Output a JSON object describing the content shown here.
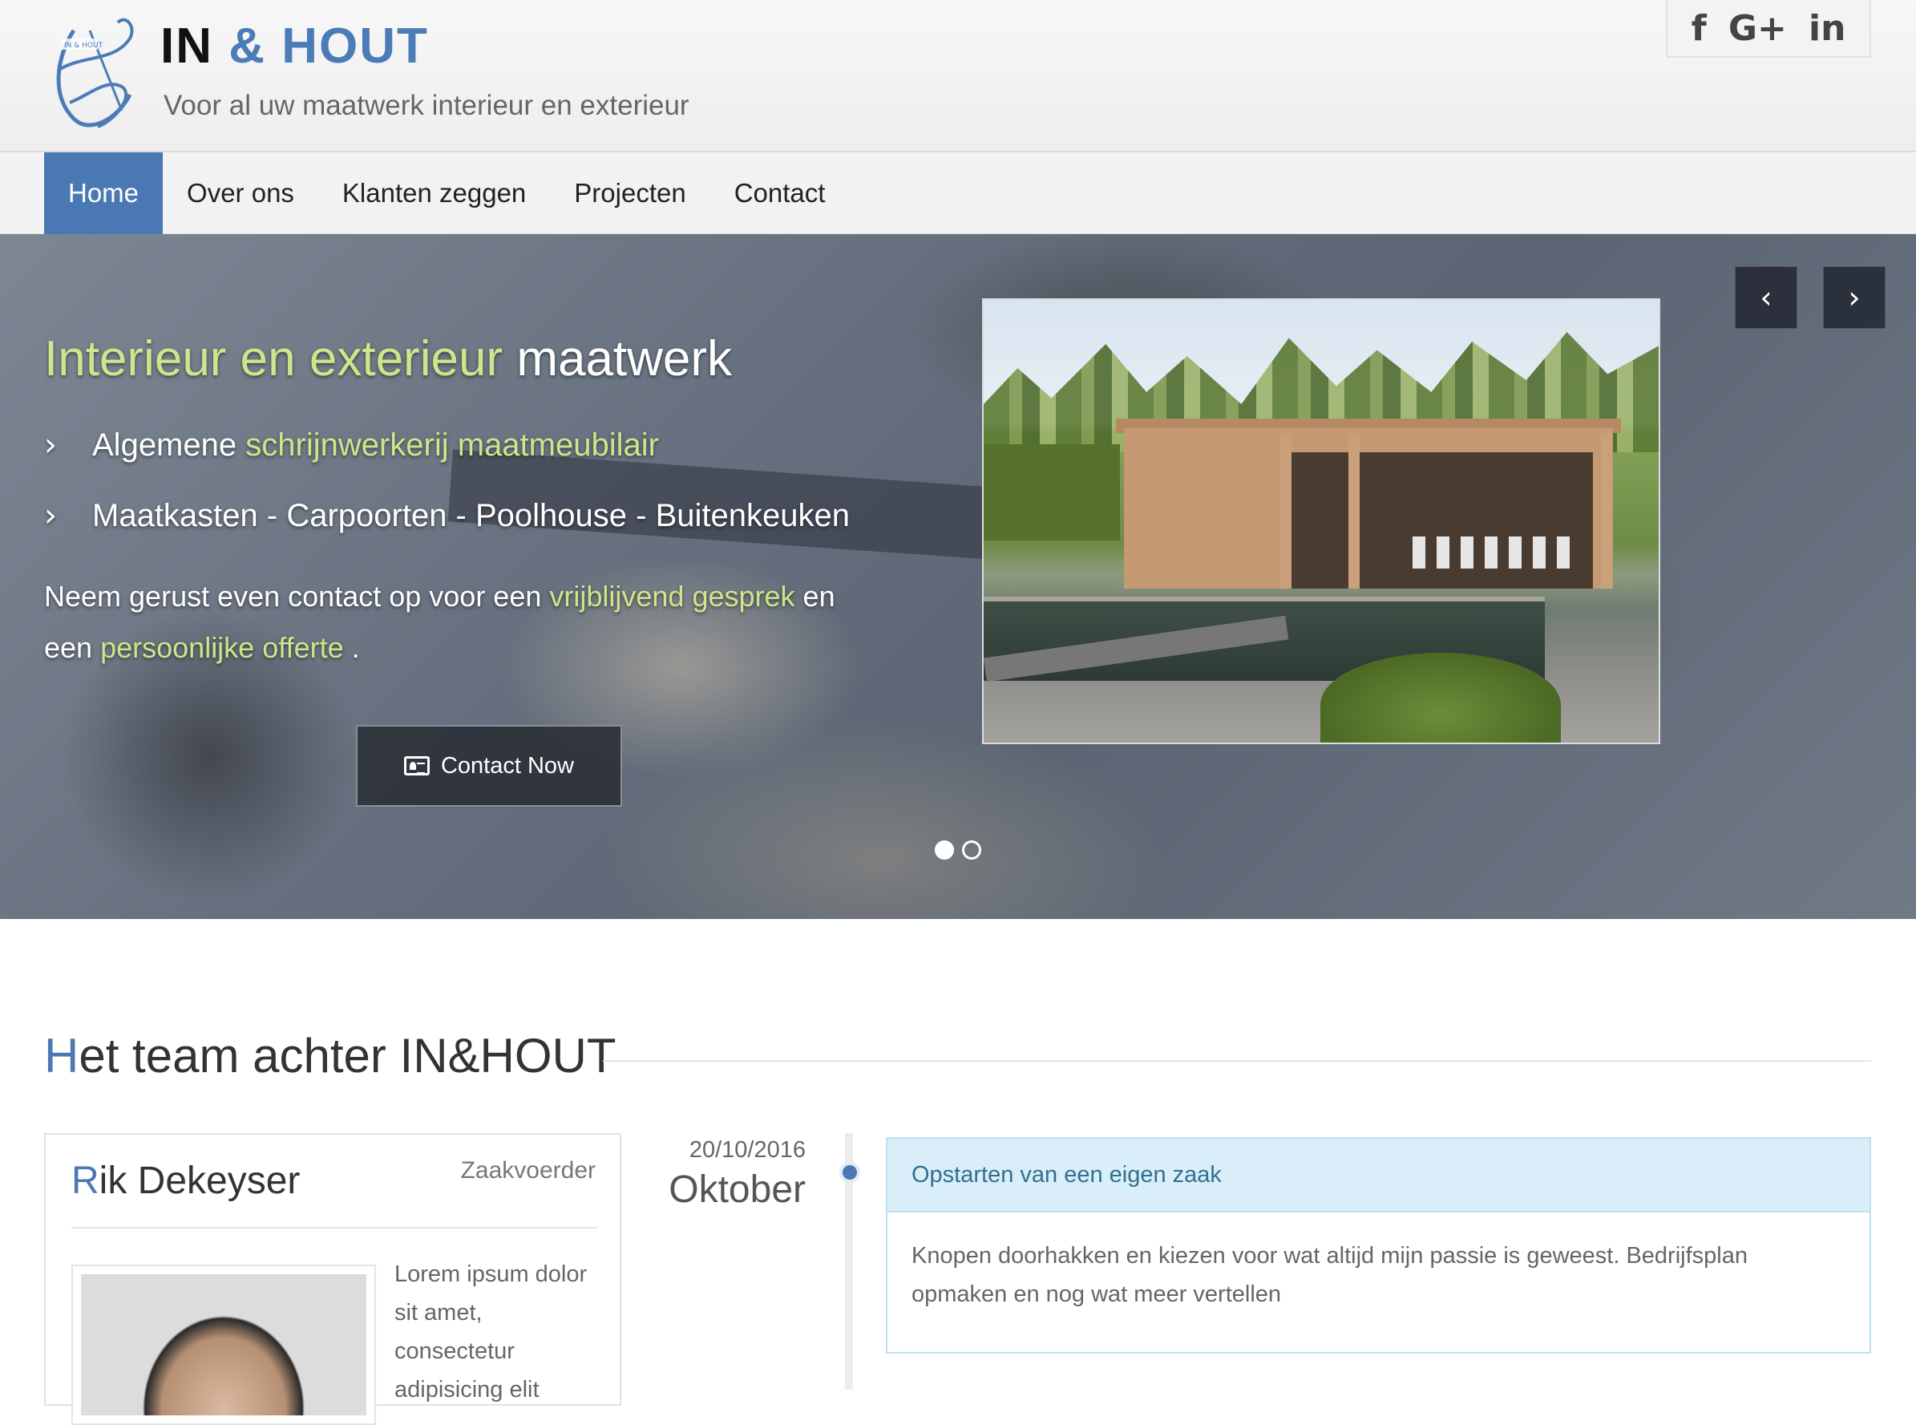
{
  "brand": {
    "in": "IN",
    "amp": "&",
    "hout": "HOUT",
    "tagline": "Voor al uw maatwerk interieur en exterieur"
  },
  "social": [
    {
      "name": "facebook-icon",
      "glyph": "f"
    },
    {
      "name": "google-plus-icon",
      "glyph": "G+"
    },
    {
      "name": "linkedin-icon",
      "glyph": "in"
    }
  ],
  "nav": {
    "items": [
      "Home",
      "Over ons",
      "Klanten zeggen",
      "Projecten",
      "Contact"
    ],
    "active": "Home"
  },
  "hero": {
    "title_hl": "Interieur en exterieur",
    "title_rest": "maatwerk",
    "item1_pre": "Algemene",
    "item1_hl": "schrijnwerkerij maatmeubilair",
    "item2": "Maatkasten - Carpoorten - Poolhouse - Buitenkeuken",
    "p_pre": "Neem gerust even contact op voor een",
    "p_hl1": "vrijblijvend gesprek",
    "p_mid": "en een",
    "p_hl2": "persoonlijke offerte",
    "p_end": ".",
    "button": "Contact Now",
    "prev_glyph": "‹",
    "next_glyph": "›",
    "slides": 2,
    "active_slide": 1
  },
  "team_section": {
    "title_first": "H",
    "title_rest": "et team achter IN&HOUT"
  },
  "member": {
    "name_first": "R",
    "name_rest": "ik Dekeyser",
    "role": "Zaakvoerder",
    "bio": "Lorem ipsum dolor sit amet, consectetur adipisicing elit"
  },
  "timeline": {
    "date": "20/10/2016",
    "month": "Oktober",
    "heading": "Opstarten van een eigen zaak",
    "body": "Knopen doorhakken en kiezen voor wat altijd mijn passie is geweest. Bedrijfsplan opmaken en nog wat meer vertellen"
  },
  "colors": {
    "accent": "#4a78b3",
    "highlight": "#cfe58a",
    "info_bg": "#d9eef8",
    "info_text": "#31708f"
  }
}
